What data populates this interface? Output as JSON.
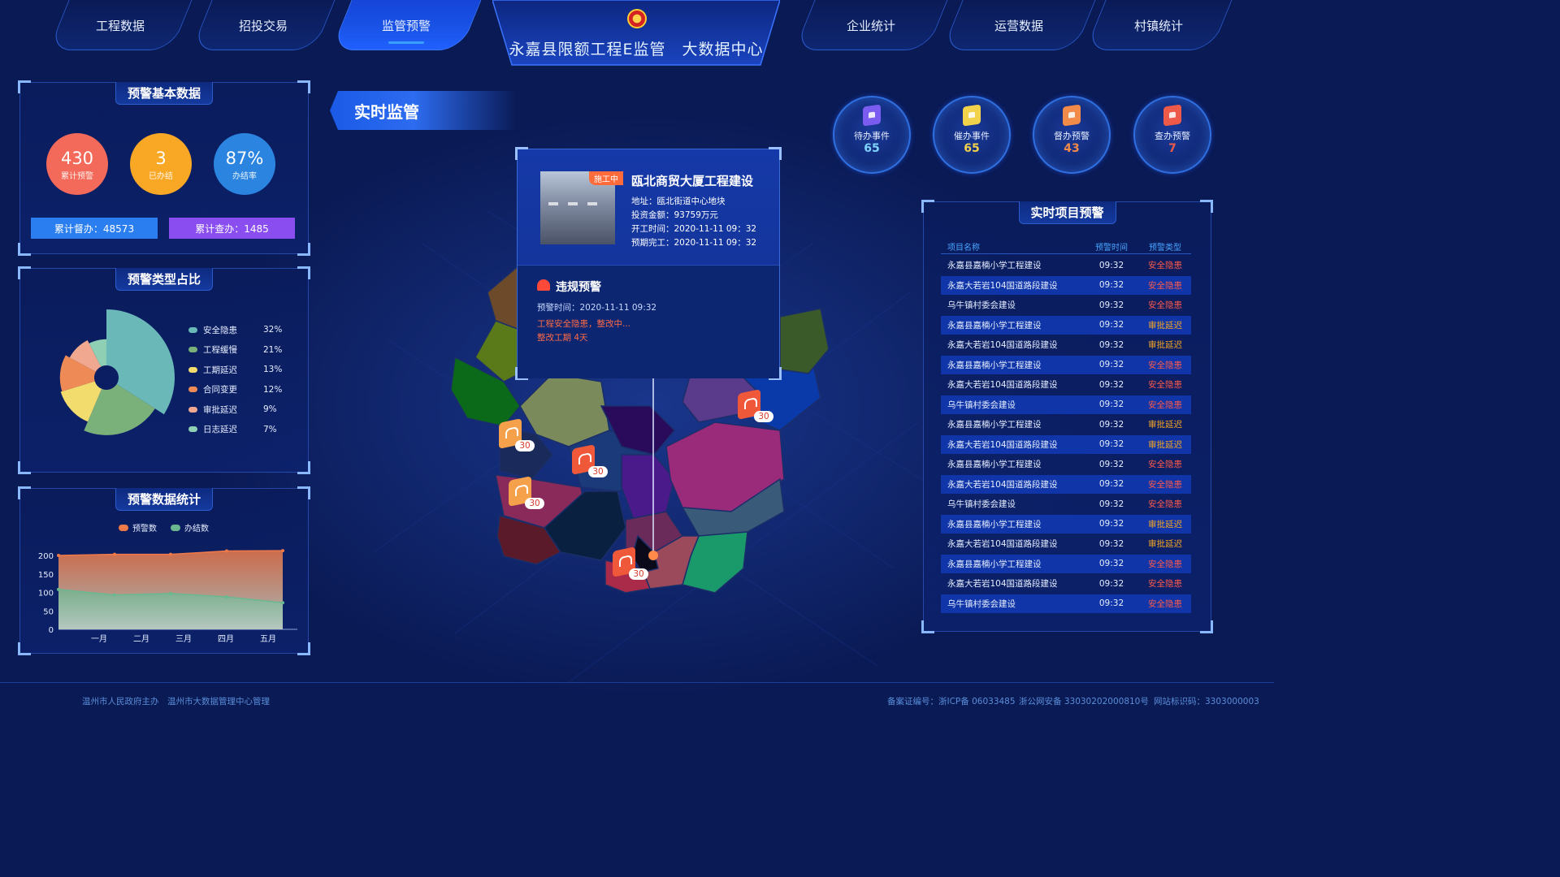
{
  "nav": {
    "left": [
      "工程数据",
      "招投交易",
      "监管预警"
    ],
    "right": [
      "企业统计",
      "运营数据",
      "村镇统计"
    ],
    "active": "监管预警"
  },
  "site_title": "永嘉县限额工程E监管　大数据中心",
  "basic": {
    "title": "预警基本数据",
    "stats": [
      {
        "value": "430",
        "label": "累计预警",
        "color": "#f46a5a"
      },
      {
        "value": "3",
        "label": "已办结",
        "color": "#f9a825"
      },
      {
        "value": "87%",
        "label": "办结率",
        "color": "#2a84e0"
      }
    ],
    "total_supervise": "累计督办：48573",
    "total_inspect": "累计查办：1485"
  },
  "types": {
    "title": "预警类型占比",
    "items": [
      {
        "name": "安全隐患",
        "pct": "32%",
        "value": 32,
        "color": "#6ab8b8"
      },
      {
        "name": "工程缓慢",
        "pct": "21%",
        "value": 21,
        "color": "#7ab07a"
      },
      {
        "name": "工期延迟",
        "pct": "13%",
        "value": 13,
        "color": "#f2dc6e"
      },
      {
        "name": "合同变更",
        "pct": "12%",
        "value": 12,
        "color": "#ee8a55"
      },
      {
        "name": "审批延迟",
        "pct": "9%",
        "value": 9,
        "color": "#f0a890"
      },
      {
        "name": "日志延迟",
        "pct": "7%",
        "value": 7,
        "color": "#8fd0b4"
      }
    ]
  },
  "stats_panel": {
    "title": "预警数据统计",
    "chart_data": {
      "type": "area",
      "categories": [
        "一月",
        "二月",
        "三月",
        "四月",
        "五月"
      ],
      "series": [
        {
          "name": "预警数",
          "values": [
            200,
            203,
            203,
            212,
            213
          ],
          "color": "#ee7a4a"
        },
        {
          "name": "办结数",
          "values": [
            108,
            93,
            97,
            88,
            72
          ],
          "color": "#6ab890"
        }
      ],
      "ylim": [
        0,
        200
      ],
      "yticks": [
        0,
        50,
        100,
        150,
        200
      ]
    }
  },
  "realtime": {
    "banner": "实时监管",
    "counters": [
      {
        "label": "待办事件",
        "value": "65",
        "icon": "#7b5cf0",
        "color": "#7fd4ff"
      },
      {
        "label": "催办事件",
        "value": "65",
        "icon": "#f2d24a",
        "color": "#f2d24a"
      },
      {
        "label": "督办预警",
        "value": "43",
        "icon": "#f28a4a",
        "color": "#f28a4a"
      },
      {
        "label": "查办预警",
        "value": "7",
        "icon": "#ee5a4a",
        "color": "#ee5a4a"
      }
    ]
  },
  "popup": {
    "status": "施工中",
    "name": "瓯北商贸大厦工程建设",
    "address": "地址：瓯北街道中心地块",
    "investment": "投资金额：93759万元",
    "start": "开工时间：2020-11-11 09：32",
    "expected_end": "预期完工：2020-11-11 09：32",
    "alert_title": "违规预警",
    "alert_time": "预警时间：2020-11-11 09:32",
    "alert_msg": "工程安全隐患，整改中...",
    "alert_deadline": "整改工期 4天"
  },
  "markers": [
    "30",
    "30",
    "30",
    "30",
    "30"
  ],
  "table": {
    "title": "实时项目预警",
    "headers": [
      "项目名称",
      "预警时间",
      "预警类型"
    ],
    "rows": [
      [
        "永嘉县嘉楠小学工程建设",
        "09:32",
        "安全隐患"
      ],
      [
        "永嘉大若岩104国道路段建设",
        "09:32",
        "安全隐患"
      ],
      [
        "乌牛镇村委会建设",
        "09:32",
        "安全隐患"
      ],
      [
        "永嘉县嘉楠小学工程建设",
        "09:32",
        "审批延迟"
      ],
      [
        "永嘉大若岩104国道路段建设",
        "09:32",
        "审批延迟"
      ],
      [
        "永嘉县嘉楠小学工程建设",
        "09:32",
        "安全隐患"
      ],
      [
        "永嘉大若岩104国道路段建设",
        "09:32",
        "安全隐患"
      ],
      [
        "乌牛镇村委会建设",
        "09:32",
        "安全隐患"
      ],
      [
        "永嘉县嘉楠小学工程建设",
        "09:32",
        "审批延迟"
      ],
      [
        "永嘉大若岩104国道路段建设",
        "09:32",
        "审批延迟"
      ],
      [
        "永嘉县嘉楠小学工程建设",
        "09:32",
        "安全隐患"
      ],
      [
        "永嘉大若岩104国道路段建设",
        "09:32",
        "安全隐患"
      ],
      [
        "乌牛镇村委会建设",
        "09:32",
        "安全隐患"
      ],
      [
        "永嘉县嘉楠小学工程建设",
        "09:32",
        "审批延迟"
      ],
      [
        "永嘉大若岩104国道路段建设",
        "09:32",
        "审批延迟"
      ],
      [
        "永嘉县嘉楠小学工程建设",
        "09:32",
        "安全隐患"
      ],
      [
        "永嘉大若岩104国道路段建设",
        "09:32",
        "安全隐患"
      ],
      [
        "乌牛镇村委会建设",
        "09:32",
        "安全隐患"
      ]
    ],
    "type_colors": {
      "安全隐患": "#ff5a4a",
      "审批延迟": "#f5a623"
    }
  },
  "footer": {
    "host": "温州市人民政府主办",
    "manager": "温州市大数据管理中心管理",
    "icp": "备案证编号：浙ICP备 06033485",
    "police": "浙公网安备 33030202000810号",
    "site_id": "网站标识码：3303000003"
  }
}
